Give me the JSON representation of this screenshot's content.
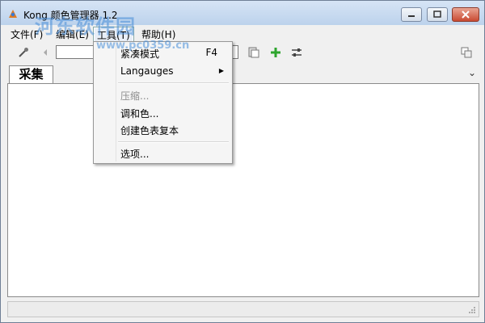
{
  "window": {
    "title": "Kong 颜色管理器 1.2"
  },
  "menubar": {
    "items": [
      {
        "label": "文件(F)"
      },
      {
        "label": "编辑(E)"
      },
      {
        "label": "工具(T)"
      },
      {
        "label": "帮助(H)"
      }
    ]
  },
  "toolbar": {
    "color_value": ""
  },
  "tabs": [
    {
      "label": "采集"
    }
  ],
  "tools_menu": {
    "items": [
      {
        "label": "紧凑模式",
        "shortcut": "F4"
      },
      {
        "label": "Langauges",
        "submenu": true
      },
      {
        "label": "压缩...",
        "disabled": true
      },
      {
        "label": "调和色..."
      },
      {
        "label": "创建色表复本"
      },
      {
        "label": "选项..."
      }
    ]
  },
  "watermark": {
    "name": "河东软件园",
    "url": "www.pc0359.cn"
  },
  "colors": {
    "titlebar": "#c6d9f0",
    "close_button": "#c94a32",
    "accent_green": "#2ea52e"
  }
}
